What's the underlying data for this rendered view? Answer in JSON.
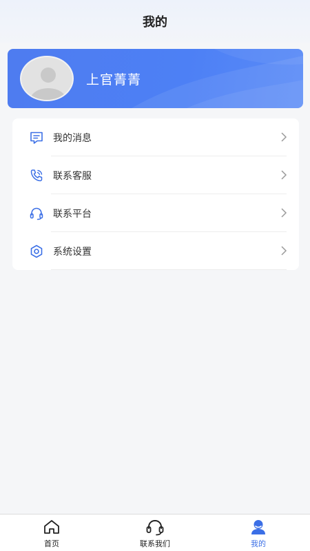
{
  "header": {
    "title": "我的"
  },
  "profile": {
    "username": "上官菁菁"
  },
  "menu": {
    "items": [
      {
        "label": "我的消息",
        "icon": "message-icon"
      },
      {
        "label": "联系客服",
        "icon": "phone-icon"
      },
      {
        "label": "联系平台",
        "icon": "headset-icon"
      },
      {
        "label": "系统设置",
        "icon": "settings-icon"
      }
    ]
  },
  "bottom_nav": {
    "items": [
      {
        "label": "首页",
        "icon": "home-icon",
        "active": false
      },
      {
        "label": "联系我们",
        "icon": "headset-icon",
        "active": false
      },
      {
        "label": "我的",
        "icon": "user-icon",
        "active": true
      }
    ]
  },
  "colors": {
    "accent": "#4e7cf0",
    "icon_blue": "#3b6fe6",
    "background": "#f5f6f8"
  }
}
